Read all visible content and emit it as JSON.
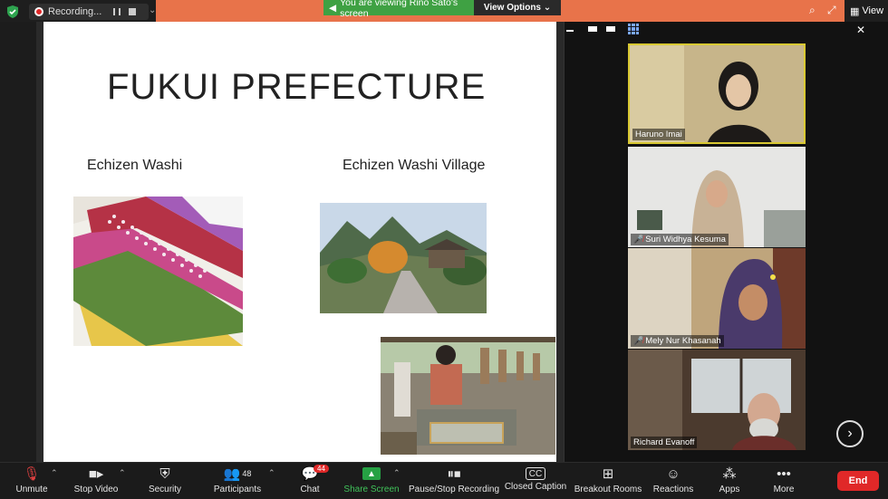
{
  "topbar": {
    "recording_label": "Recording...",
    "viewing_banner": "You are viewing Rino Sato's screen",
    "view_options": "View Options",
    "view_label": "View"
  },
  "slide": {
    "title": "FUKUI PREFECTURE",
    "label_left": "Echizen Washi",
    "label_right": "Echizen Washi Village"
  },
  "participants": [
    {
      "name": "Haruno Imai",
      "muted": false
    },
    {
      "name": "Suri Widhya Kesuma",
      "muted": true
    },
    {
      "name": "Mely Nur Khasanah",
      "muted": true
    },
    {
      "name": "Richard Evanoff",
      "muted": false
    }
  ],
  "toolbar": {
    "unmute": "Unmute",
    "stop_video": "Stop Video",
    "security": "Security",
    "participants": "Participants",
    "participants_count": "48",
    "chat": "Chat",
    "chat_badge": "44",
    "share_screen": "Share Screen",
    "recording": "Pause/Stop Recording",
    "closed_caption": "Closed Caption",
    "breakout_rooms": "Breakout Rooms",
    "reactions": "Reactions",
    "apps": "Apps",
    "more": "More",
    "end": "End"
  },
  "colors": {
    "accent_green": "#3fa143",
    "end_red": "#e02828",
    "top_strip": "#e8734a"
  },
  "icons": [
    "shield-icon",
    "record-icon",
    "search-icon",
    "fullscreen-icon",
    "microphone-muted-icon",
    "video-camera-icon",
    "security-shield-icon",
    "participants-icon",
    "chat-icon",
    "share-arrow-icon",
    "pause-stop-icon",
    "cc-icon",
    "breakout-grid-icon",
    "reaction-smile-icon",
    "apps-icon",
    "more-dots-icon"
  ]
}
